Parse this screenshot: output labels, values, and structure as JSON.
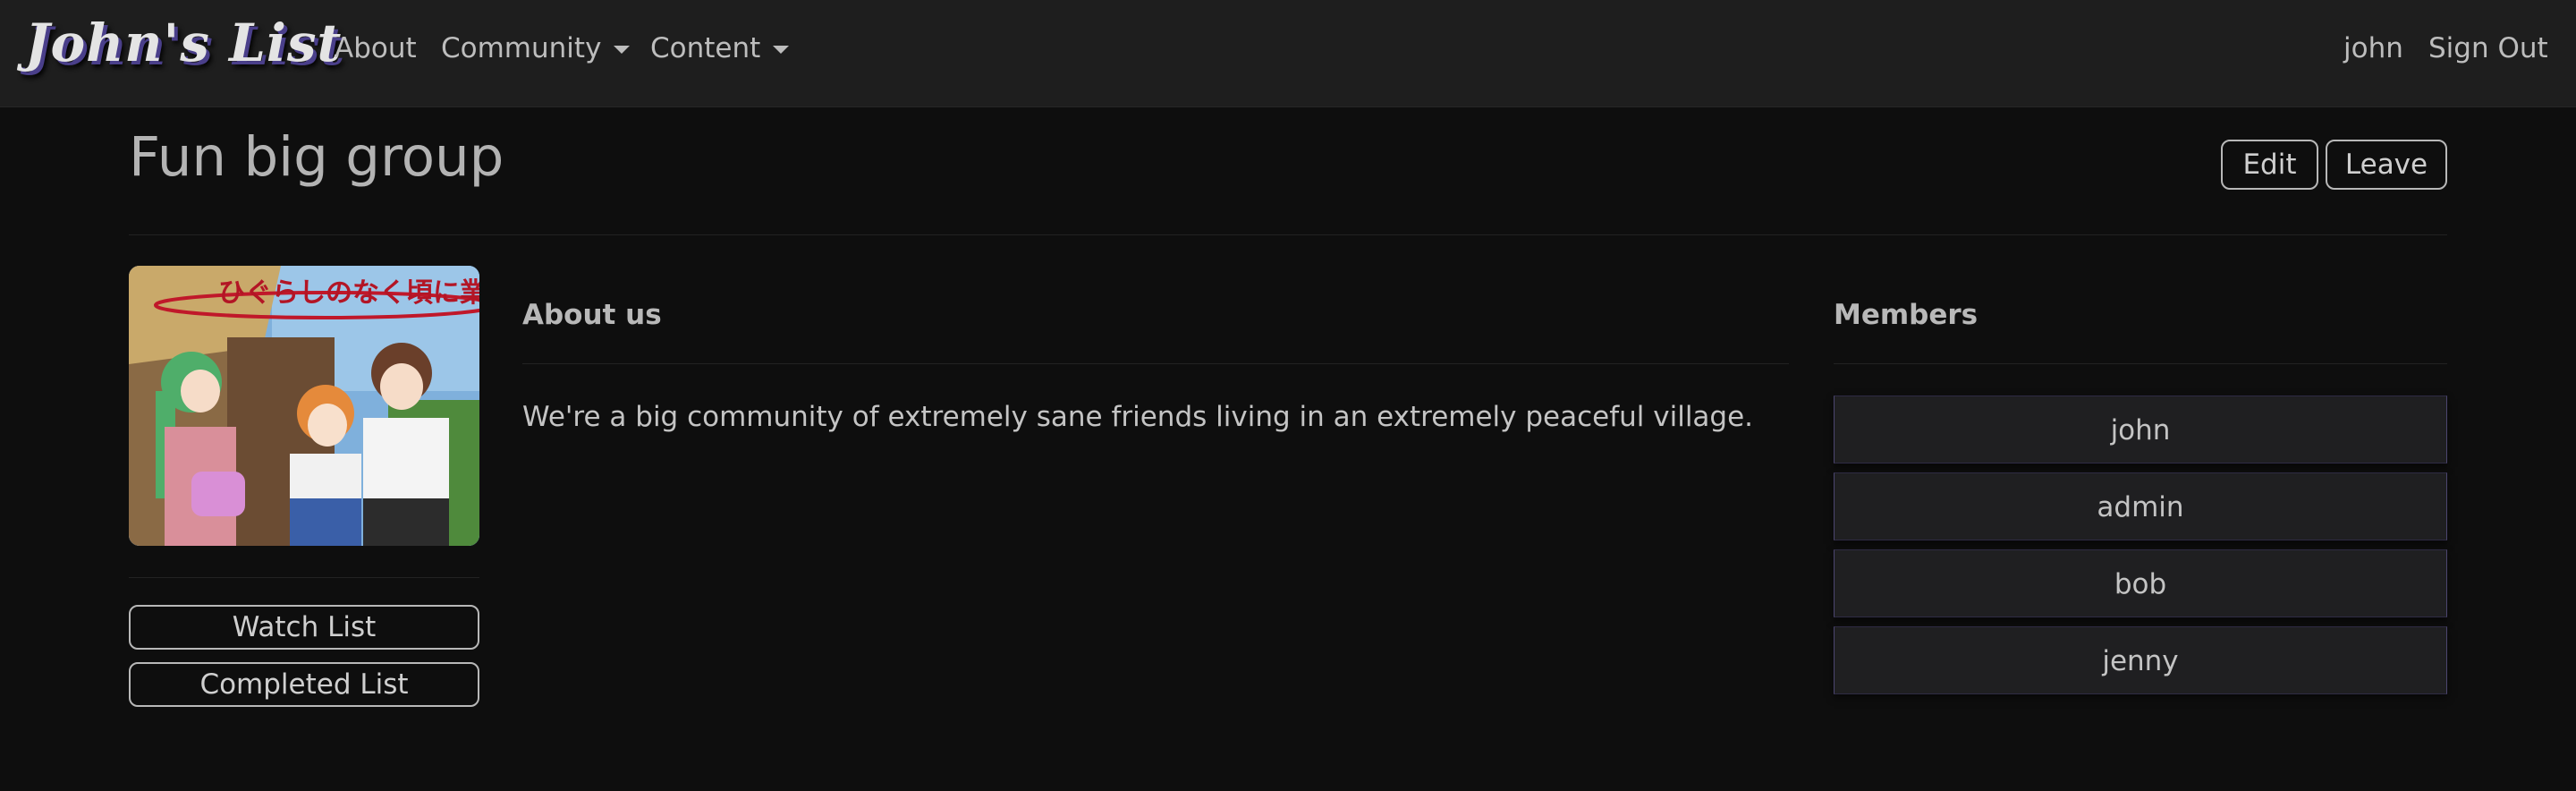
{
  "navbar": {
    "brand": "John's List",
    "links": {
      "about": "About",
      "community": "Community",
      "content": "Content"
    },
    "user": "john",
    "sign_out": "Sign Out"
  },
  "group": {
    "title": "Fun big group",
    "edit_label": "Edit",
    "leave_label": "Leave",
    "cover_title_text": "ひぐらしのなく頃に業",
    "watch_list_label": "Watch List",
    "completed_list_label": "Completed List"
  },
  "about": {
    "heading": "About us",
    "text": "We're a big community of extremely sane friends living in an extremely peaceful village."
  },
  "members": {
    "heading": "Members",
    "list": [
      "john",
      "admin",
      "bob",
      "jenny"
    ]
  },
  "colors": {
    "navbar_bg": "#1e1e1e",
    "page_bg": "#0e0e0e",
    "member_border": "#4c4670",
    "brand_shadow": "#4a3f8a"
  }
}
